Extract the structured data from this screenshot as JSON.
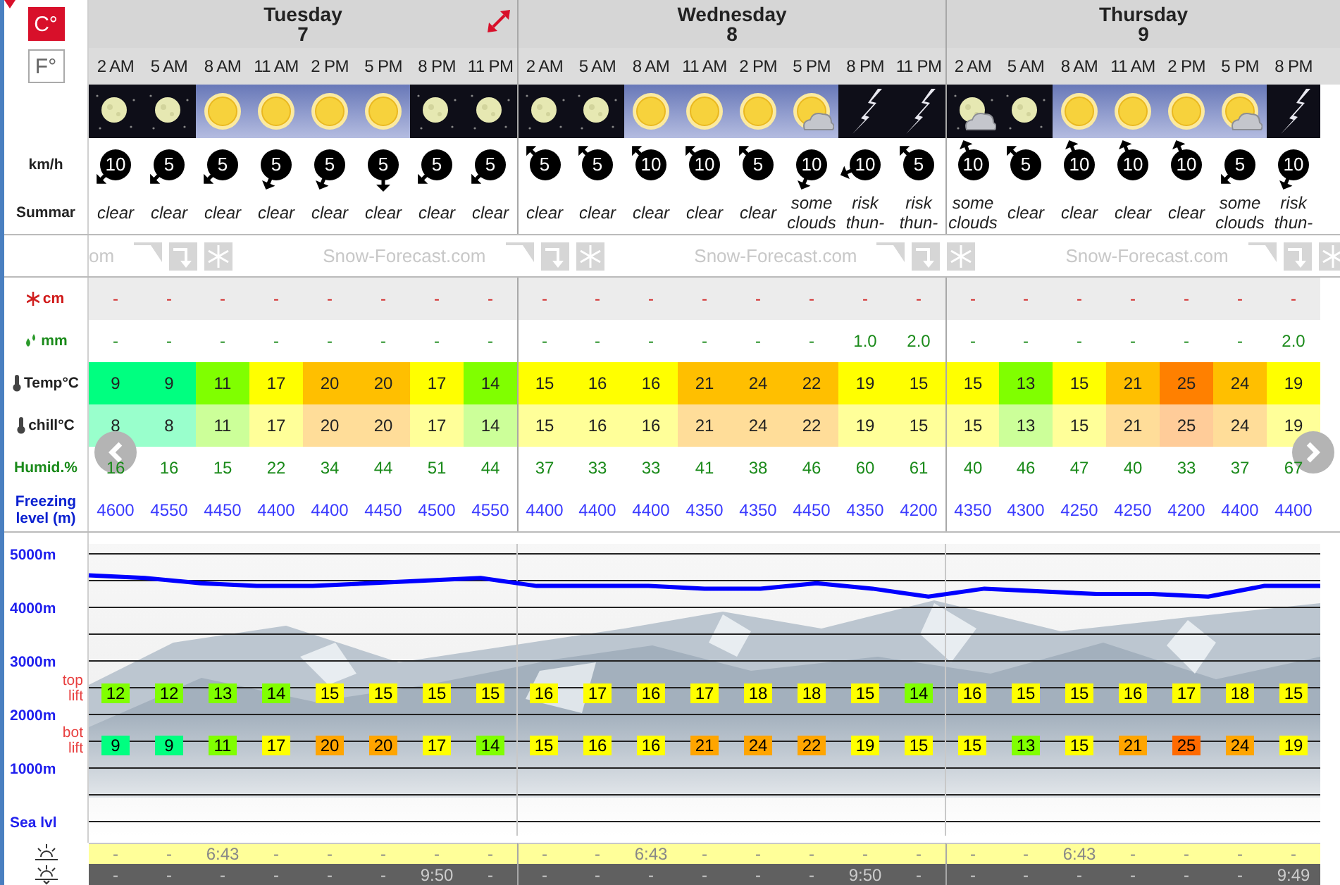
{
  "units": [
    {
      "label": "C°",
      "selected": true
    },
    {
      "label": "F°",
      "selected": false
    }
  ],
  "row_labels": {
    "wind": "km/h",
    "summary": "Summar",
    "snow": "cm",
    "rain": "mm",
    "temp": "Temp°C",
    "chill": "chill°C",
    "humid": "Humid.%",
    "freezing": "Freezing level (m)"
  },
  "brand_strip": [
    "om",
    "Snow-Forecast.com",
    "Snow-Forecast.com",
    "Snow-Forecast.com"
  ],
  "days": [
    {
      "name": "Tuesday",
      "date": "7",
      "expand_button": true,
      "columns": [
        {
          "time": "2 AM",
          "kind": "moon",
          "wind": {
            "speed": "10",
            "kind": "SW"
          },
          "summary": "clear",
          "snow": "-",
          "rain": "-",
          "temp": {
            "value": "9",
            "color": "#00ff80"
          },
          "chill": {
            "value": "8",
            "color": "#99ffcc"
          },
          "humid": "16",
          "freezing": "4600",
          "top_lift": {
            "value": "12",
            "color": "#80ff00"
          },
          "bot_lift": {
            "value": "9",
            "color": "#00ff80"
          },
          "sunrise": "-",
          "sunset": "-"
        },
        {
          "time": "5 AM",
          "kind": "moon",
          "wind": {
            "speed": "5",
            "kind": "SW"
          },
          "summary": "clear",
          "snow": "-",
          "rain": "-",
          "temp": {
            "value": "9",
            "color": "#00ff80"
          },
          "chill": {
            "value": "8",
            "color": "#99ffcc"
          },
          "humid": "16",
          "freezing": "4550",
          "top_lift": {
            "value": "12",
            "color": "#80ff00"
          },
          "bot_lift": {
            "value": "9",
            "color": "#00ff80"
          },
          "sunrise": "-",
          "sunset": "-"
        },
        {
          "time": "8 AM",
          "kind": "sun",
          "wind": {
            "speed": "5",
            "kind": "SW"
          },
          "summary": "clear",
          "snow": "-",
          "rain": "-",
          "temp": {
            "value": "11",
            "color": "#80ff00"
          },
          "chill": {
            "value": "11",
            "color": "#ccff99"
          },
          "humid": "15",
          "freezing": "4450",
          "top_lift": {
            "value": "13",
            "color": "#80ff00"
          },
          "bot_lift": {
            "value": "11",
            "color": "#80ff00"
          },
          "sunrise": "6:43",
          "sunset": "-"
        },
        {
          "time": "11 AM",
          "kind": "sun",
          "wind": {
            "speed": "5",
            "kind": "SSW"
          },
          "summary": "clear",
          "snow": "-",
          "rain": "-",
          "temp": {
            "value": "17",
            "color": "#ffff00"
          },
          "chill": {
            "value": "17",
            "color": "#ffff99"
          },
          "humid": "22",
          "freezing": "4400",
          "top_lift": {
            "value": "14",
            "color": "#80ff00"
          },
          "bot_lift": {
            "value": "17",
            "color": "#ffff00"
          },
          "sunrise": "-",
          "sunset": "-"
        },
        {
          "time": "2 PM",
          "kind": "sun",
          "wind": {
            "speed": "5",
            "kind": "SSW"
          },
          "summary": "clear",
          "snow": "-",
          "rain": "-",
          "temp": {
            "value": "20",
            "color": "#ffbf00"
          },
          "chill": {
            "value": "20",
            "color": "#ffdd99"
          },
          "humid": "34",
          "freezing": "4400",
          "top_lift": {
            "value": "15",
            "color": "#ffff00"
          },
          "bot_lift": {
            "value": "20",
            "color": "#ffa500"
          },
          "sunrise": "-",
          "sunset": "-"
        },
        {
          "time": "5 PM",
          "kind": "sun",
          "wind": {
            "speed": "5",
            "kind": "S"
          },
          "summary": "clear",
          "snow": "-",
          "rain": "-",
          "temp": {
            "value": "20",
            "color": "#ffbf00"
          },
          "chill": {
            "value": "20",
            "color": "#ffdd99"
          },
          "humid": "44",
          "freezing": "4450",
          "top_lift": {
            "value": "15",
            "color": "#ffff00"
          },
          "bot_lift": {
            "value": "20",
            "color": "#ffa500"
          },
          "sunrise": "-",
          "sunset": "-"
        },
        {
          "time": "8 PM",
          "kind": "moon",
          "wind": {
            "speed": "5",
            "kind": "SW"
          },
          "summary": "clear",
          "snow": "-",
          "rain": "-",
          "temp": {
            "value": "17",
            "color": "#ffff00"
          },
          "chill": {
            "value": "17",
            "color": "#ffff99"
          },
          "humid": "51",
          "freezing": "4500",
          "top_lift": {
            "value": "15",
            "color": "#ffff00"
          },
          "bot_lift": {
            "value": "17",
            "color": "#ffff00"
          },
          "sunrise": "-",
          "sunset": "9:50"
        },
        {
          "time": "11 PM",
          "kind": "moon",
          "wind": {
            "speed": "5",
            "kind": "SW"
          },
          "summary": "clear",
          "snow": "-",
          "rain": "-",
          "temp": {
            "value": "14",
            "color": "#80ff00"
          },
          "chill": {
            "value": "14",
            "color": "#ccff99"
          },
          "humid": "44",
          "freezing": "4550",
          "top_lift": {
            "value": "15",
            "color": "#ffff00"
          },
          "bot_lift": {
            "value": "14",
            "color": "#80ff00"
          },
          "sunrise": "-",
          "sunset": "-"
        }
      ]
    },
    {
      "name": "Wednesday",
      "date": "8",
      "columns": [
        {
          "time": "2 AM",
          "kind": "moon",
          "wind": {
            "speed": "5",
            "kind": "NW"
          },
          "summary": "clear",
          "snow": "-",
          "rain": "-",
          "temp": {
            "value": "15",
            "color": "#ffff00"
          },
          "chill": {
            "value": "15",
            "color": "#ffff99"
          },
          "humid": "37",
          "freezing": "4400",
          "top_lift": {
            "value": "16",
            "color": "#ffff00"
          },
          "bot_lift": {
            "value": "15",
            "color": "#ffff00"
          },
          "sunrise": "-",
          "sunset": "-"
        },
        {
          "time": "5 AM",
          "kind": "moon",
          "wind": {
            "speed": "5",
            "kind": "NW"
          },
          "summary": "clear",
          "snow": "-",
          "rain": "-",
          "temp": {
            "value": "16",
            "color": "#ffff00"
          },
          "chill": {
            "value": "16",
            "color": "#ffff99"
          },
          "humid": "33",
          "freezing": "4400",
          "top_lift": {
            "value": "17",
            "color": "#ffff00"
          },
          "bot_lift": {
            "value": "16",
            "color": "#ffff00"
          },
          "sunrise": "-",
          "sunset": "-"
        },
        {
          "time": "8 AM",
          "kind": "sun",
          "wind": {
            "speed": "10",
            "kind": "NW"
          },
          "summary": "clear",
          "snow": "-",
          "rain": "-",
          "temp": {
            "value": "16",
            "color": "#ffff00"
          },
          "chill": {
            "value": "16",
            "color": "#ffff99"
          },
          "humid": "33",
          "freezing": "4400",
          "top_lift": {
            "value": "16",
            "color": "#ffff00"
          },
          "bot_lift": {
            "value": "16",
            "color": "#ffff00"
          },
          "sunrise": "6:43",
          "sunset": "-"
        },
        {
          "time": "11 AM",
          "kind": "sun",
          "wind": {
            "speed": "10",
            "kind": "NW"
          },
          "summary": "clear",
          "snow": "-",
          "rain": "-",
          "temp": {
            "value": "21",
            "color": "#ffbf00"
          },
          "chill": {
            "value": "21",
            "color": "#ffdd99"
          },
          "humid": "41",
          "freezing": "4350",
          "top_lift": {
            "value": "17",
            "color": "#ffff00"
          },
          "bot_lift": {
            "value": "21",
            "color": "#ffa500"
          },
          "sunrise": "-",
          "sunset": "-"
        },
        {
          "time": "2 PM",
          "kind": "sun",
          "wind": {
            "speed": "5",
            "kind": "NW"
          },
          "summary": "clear",
          "snow": "-",
          "rain": "-",
          "temp": {
            "value": "24",
            "color": "#ffbf00"
          },
          "chill": {
            "value": "24",
            "color": "#ffdd99"
          },
          "humid": "38",
          "freezing": "4350",
          "top_lift": {
            "value": "18",
            "color": "#ffff00"
          },
          "bot_lift": {
            "value": "24",
            "color": "#ffa500"
          },
          "sunrise": "-",
          "sunset": "-"
        },
        {
          "time": "5 PM",
          "kind": "sun-cloud",
          "wind": {
            "speed": "10",
            "kind": "SSW"
          },
          "summary": "some clouds",
          "snow": "-",
          "rain": "-",
          "temp": {
            "value": "22",
            "color": "#ffbf00"
          },
          "chill": {
            "value": "22",
            "color": "#ffdd99"
          },
          "humid": "46",
          "freezing": "4450",
          "top_lift": {
            "value": "18",
            "color": "#ffff00"
          },
          "bot_lift": {
            "value": "22",
            "color": "#ffa500"
          },
          "sunrise": "-",
          "sunset": "-"
        },
        {
          "time": "8 PM",
          "kind": "thunder",
          "wind": {
            "speed": "10",
            "kind": "WSW"
          },
          "summary": "risk thun-",
          "snow": "-",
          "rain": "1.0",
          "temp": {
            "value": "19",
            "color": "#ffff00"
          },
          "chill": {
            "value": "19",
            "color": "#ffff99"
          },
          "humid": "60",
          "freezing": "4350",
          "top_lift": {
            "value": "15",
            "color": "#ffff00"
          },
          "bot_lift": {
            "value": "19",
            "color": "#ffff00"
          },
          "sunrise": "-",
          "sunset": "9:50"
        },
        {
          "time": "11 PM",
          "kind": "thunder",
          "wind": {
            "speed": "5",
            "kind": "NW"
          },
          "summary": "risk thun-",
          "snow": "-",
          "rain": "2.0",
          "temp": {
            "value": "15",
            "color": "#ffff00"
          },
          "chill": {
            "value": "15",
            "color": "#ffff99"
          },
          "humid": "61",
          "freezing": "4200",
          "top_lift": {
            "value": "14",
            "color": "#80ff00"
          },
          "bot_lift": {
            "value": "15",
            "color": "#ffff00"
          },
          "sunrise": "-",
          "sunset": "-"
        }
      ]
    },
    {
      "name": "Thursday",
      "date": "9",
      "columns": [
        {
          "time": "2 AM",
          "kind": "moon-cloud",
          "wind": {
            "speed": "10",
            "kind": "NNW"
          },
          "summary": "some clouds",
          "snow": "-",
          "rain": "-",
          "temp": {
            "value": "15",
            "color": "#ffff00"
          },
          "chill": {
            "value": "15",
            "color": "#ffff99"
          },
          "humid": "40",
          "freezing": "4350",
          "top_lift": {
            "value": "16",
            "color": "#ffff00"
          },
          "bot_lift": {
            "value": "15",
            "color": "#ffff00"
          },
          "sunrise": "-",
          "sunset": "-"
        },
        {
          "time": "5 AM",
          "kind": "moon",
          "wind": {
            "speed": "5",
            "kind": "NW"
          },
          "summary": "clear",
          "snow": "-",
          "rain": "-",
          "temp": {
            "value": "13",
            "color": "#80ff00"
          },
          "chill": {
            "value": "13",
            "color": "#ccff99"
          },
          "humid": "46",
          "freezing": "4300",
          "top_lift": {
            "value": "15",
            "color": "#ffff00"
          },
          "bot_lift": {
            "value": "13",
            "color": "#80ff00"
          },
          "sunrise": "-",
          "sunset": "-"
        },
        {
          "time": "8 AM",
          "kind": "sun",
          "wind": {
            "speed": "10",
            "kind": "NNW"
          },
          "summary": "clear",
          "snow": "-",
          "rain": "-",
          "temp": {
            "value": "15",
            "color": "#ffff00"
          },
          "chill": {
            "value": "15",
            "color": "#ffff99"
          },
          "humid": "47",
          "freezing": "4250",
          "top_lift": {
            "value": "15",
            "color": "#ffff00"
          },
          "bot_lift": {
            "value": "15",
            "color": "#ffff00"
          },
          "sunrise": "6:43",
          "sunset": "-"
        },
        {
          "time": "11 AM",
          "kind": "sun",
          "wind": {
            "speed": "10",
            "kind": "NNW"
          },
          "summary": "clear",
          "snow": "-",
          "rain": "-",
          "temp": {
            "value": "21",
            "color": "#ffbf00"
          },
          "chill": {
            "value": "21",
            "color": "#ffdd99"
          },
          "humid": "40",
          "freezing": "4250",
          "top_lift": {
            "value": "16",
            "color": "#ffff00"
          },
          "bot_lift": {
            "value": "21",
            "color": "#ffa500"
          },
          "sunrise": "-",
          "sunset": "-"
        },
        {
          "time": "2 PM",
          "kind": "sun",
          "wind": {
            "speed": "10",
            "kind": "NNW"
          },
          "summary": "clear",
          "snow": "-",
          "rain": "-",
          "temp": {
            "value": "25",
            "color": "#ff8000"
          },
          "chill": {
            "value": "25",
            "color": "#ffcc99"
          },
          "humid": "33",
          "freezing": "4200",
          "top_lift": {
            "value": "17",
            "color": "#ffff00"
          },
          "bot_lift": {
            "value": "25",
            "color": "#ff6a00"
          },
          "sunrise": "-",
          "sunset": "-"
        },
        {
          "time": "5 PM",
          "kind": "sun-cloud",
          "wind": {
            "speed": "5",
            "kind": "SW"
          },
          "summary": "some clouds",
          "snow": "-",
          "rain": "-",
          "temp": {
            "value": "24",
            "color": "#ffbf00"
          },
          "chill": {
            "value": "24",
            "color": "#ffdd99"
          },
          "humid": "37",
          "freezing": "4400",
          "top_lift": {
            "value": "18",
            "color": "#ffff00"
          },
          "bot_lift": {
            "value": "24",
            "color": "#ffa500"
          },
          "sunrise": "-",
          "sunset": "-"
        },
        {
          "time": "8 PM",
          "kind": "thunder",
          "wind": {
            "speed": "10",
            "kind": "SSW"
          },
          "summary": "risk thun-",
          "snow": "-",
          "rain": "2.0",
          "temp": {
            "value": "19",
            "color": "#ffff00"
          },
          "chill": {
            "value": "19",
            "color": "#ffff99"
          },
          "humid": "67",
          "freezing": "4400",
          "top_lift": {
            "value": "15",
            "color": "#ffff00"
          },
          "bot_lift": {
            "value": "19",
            "color": "#ffff00"
          },
          "sunrise": "-",
          "sunset": "9:49"
        }
      ]
    }
  ],
  "lift_labels": {
    "top": "top lift",
    "bottom": "bot lift"
  },
  "chart": {
    "chart_data": {
      "type": "line",
      "grid": true,
      "ylim": [
        0,
        5000
      ],
      "yticks": [
        {
          "value": 0,
          "label": "Sea lvl"
        },
        {
          "value": 1000,
          "label": "1000m"
        },
        {
          "value": 2000,
          "label": "2000m"
        },
        {
          "value": 3000,
          "label": "3000m"
        },
        {
          "value": 4000,
          "label": "4000m"
        },
        {
          "value": 5000,
          "label": "5000m"
        }
      ],
      "series": [
        {
          "color": "#0000ff",
          "values": [
            4600,
            4550,
            4450,
            4400,
            4400,
            4450,
            4500,
            4550,
            4400,
            4400,
            4400,
            4350,
            4350,
            4450,
            4350,
            4200,
            4350,
            4300,
            4250,
            4250,
            4200,
            4400,
            4400
          ]
        }
      ]
    }
  }
}
